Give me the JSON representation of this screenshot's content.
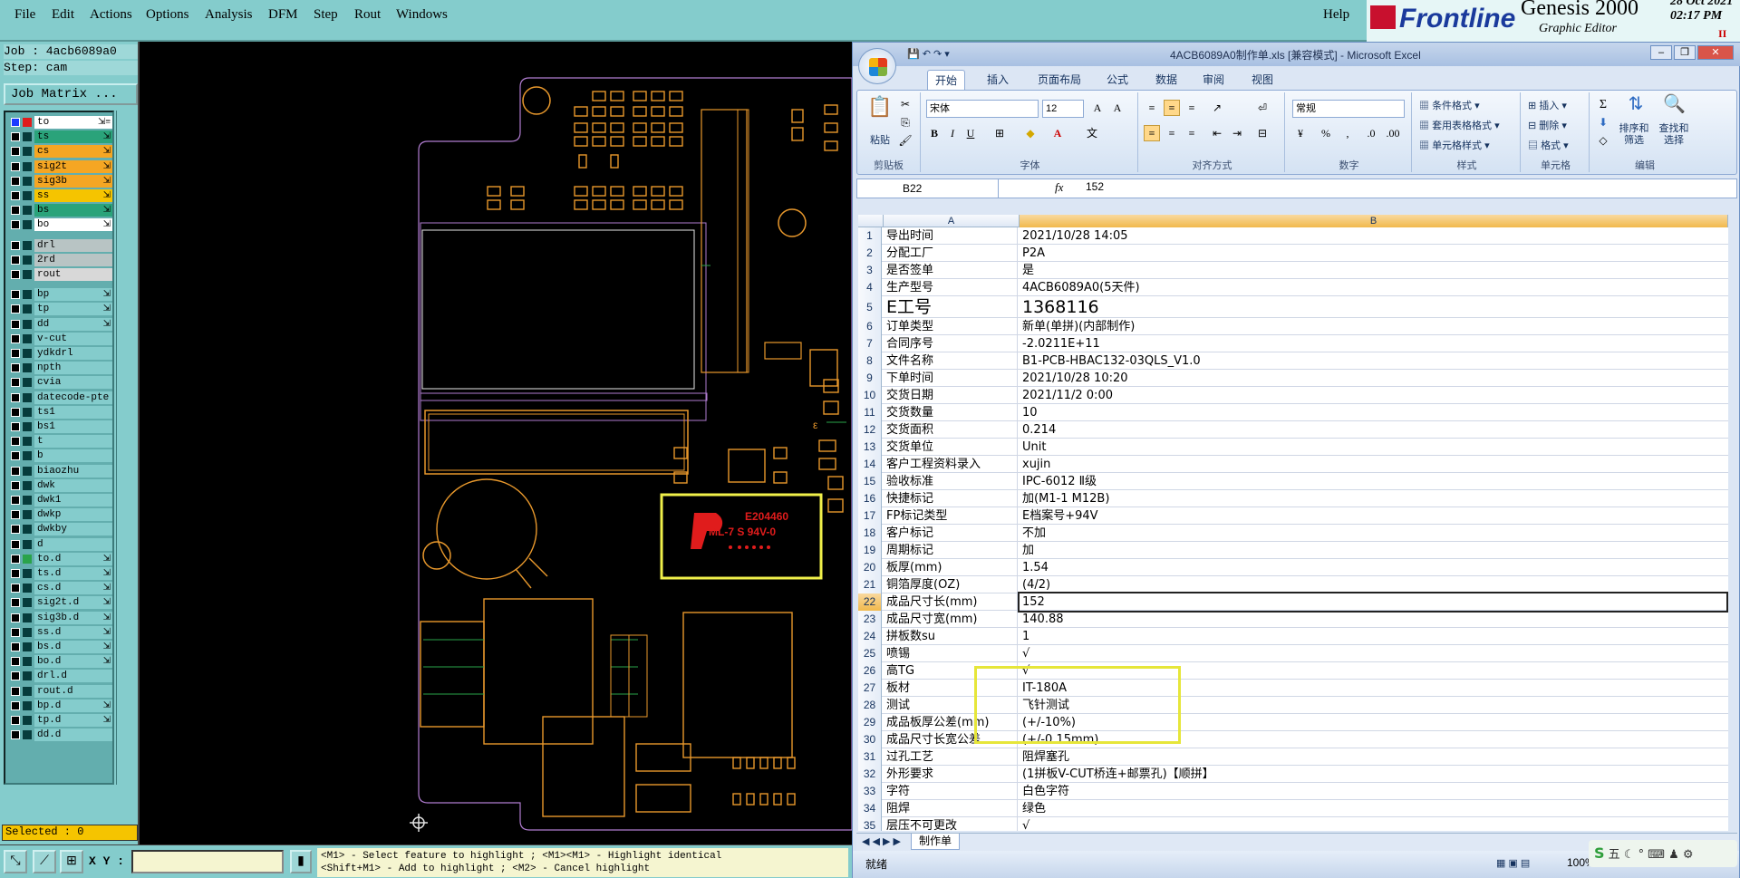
{
  "menu": {
    "file": "File",
    "edit": "Edit",
    "actions": "Actions",
    "options": "Options",
    "analysis": "Analysis",
    "dfm": "DFM",
    "step": "Step",
    "rout": "Rout",
    "windows": "Windows",
    "help": "Help"
  },
  "brand": {
    "logo": "Frontline",
    "product": "Genesis 2000",
    "subtitle": "Graphic Editor",
    "date": "28 Oct 2021",
    "time": "02:17 PM",
    "indicator": "II"
  },
  "left_panel": {
    "job": "Job : 4acb6089a0",
    "step": "Step: cam",
    "job_matrix_button": "Job Matrix ...",
    "selected": "Selected : 0",
    "layers": [
      {
        "name": "to",
        "color": "#ffffff",
        "flag": "⇲≡"
      },
      {
        "name": "ts",
        "color": "#2aa37a",
        "flag": "⇲"
      },
      {
        "name": "cs",
        "color": "#f5a623",
        "flag": "⇲"
      },
      {
        "name": "sig2t",
        "color": "#f5a623",
        "flag": "⇲"
      },
      {
        "name": "sig3b",
        "color": "#f5a623",
        "flag": "⇲"
      },
      {
        "name": "ss",
        "color": "#f5c400",
        "flag": "⇲"
      },
      {
        "name": "bs",
        "color": "#2aa37a",
        "flag": "⇲"
      },
      {
        "name": "bo",
        "color": "#ffffff",
        "flag": "⇲"
      },
      {
        "name": "drl",
        "color": "#b8c4c4",
        "flag": ""
      },
      {
        "name": "2rd",
        "color": "#b8c4c4",
        "flag": ""
      },
      {
        "name": "rout",
        "color": "#d8d8d8",
        "flag": ""
      },
      {
        "name": "bp",
        "color": "#84cccc",
        "flag": "⇲"
      },
      {
        "name": "tp",
        "color": "#84cccc",
        "flag": "⇲"
      },
      {
        "name": "dd",
        "color": "#84cccc",
        "flag": "⇲"
      },
      {
        "name": "v-cut",
        "color": "#84cccc",
        "flag": ""
      },
      {
        "name": "ydkdrl",
        "color": "#84cccc",
        "flag": ""
      },
      {
        "name": "npth",
        "color": "#84cccc",
        "flag": ""
      },
      {
        "name": "cvia",
        "color": "#84cccc",
        "flag": ""
      },
      {
        "name": "datecode-pte",
        "color": "#84cccc",
        "flag": ""
      },
      {
        "name": "ts1",
        "color": "#84cccc",
        "flag": ""
      },
      {
        "name": "bs1",
        "color": "#84cccc",
        "flag": ""
      },
      {
        "name": "t",
        "color": "#84cccc",
        "flag": ""
      },
      {
        "name": "b",
        "color": "#84cccc",
        "flag": ""
      },
      {
        "name": "biaozhu",
        "color": "#84cccc",
        "flag": ""
      },
      {
        "name": "dwk",
        "color": "#84cccc",
        "flag": ""
      },
      {
        "name": "dwk1",
        "color": "#84cccc",
        "flag": ""
      },
      {
        "name": "dwkp",
        "color": "#84cccc",
        "flag": ""
      },
      {
        "name": "dwkby",
        "color": "#84cccc",
        "flag": ""
      },
      {
        "name": "d",
        "color": "#84cccc",
        "flag": ""
      },
      {
        "name": "to.d",
        "color": "#84cccc",
        "flag": "⇲"
      },
      {
        "name": "ts.d",
        "color": "#84cccc",
        "flag": "⇲"
      },
      {
        "name": "cs.d",
        "color": "#84cccc",
        "flag": "⇲"
      },
      {
        "name": "sig2t.d",
        "color": "#84cccc",
        "flag": "⇲"
      },
      {
        "name": "sig3b.d",
        "color": "#84cccc",
        "flag": "⇲"
      },
      {
        "name": "ss.d",
        "color": "#84cccc",
        "flag": "⇲"
      },
      {
        "name": "bs.d",
        "color": "#84cccc",
        "flag": "⇲"
      },
      {
        "name": "bo.d",
        "color": "#84cccc",
        "flag": "⇲"
      },
      {
        "name": "drl.d",
        "color": "#84cccc",
        "flag": ""
      },
      {
        "name": "rout.d",
        "color": "#84cccc",
        "flag": ""
      },
      {
        "name": "bp.d",
        "color": "#84cccc",
        "flag": "⇲"
      },
      {
        "name": "tp.d",
        "color": "#84cccc",
        "flag": "⇲"
      },
      {
        "name": "dd.d",
        "color": "#84cccc",
        "flag": ""
      }
    ]
  },
  "bottom_bar": {
    "xy_label": "X Y :",
    "xy_value": "",
    "hint_line1": "<M1> - Select feature to highlight ; <M1><M1> - Highlight identical",
    "hint_line2": "<Shift+M1> - Add to highlight ; <M2> - Cancel highlight"
  },
  "canvas": {
    "marking_text1": "E204460",
    "marking_text2": "ML-7 S 94V-0"
  },
  "excel": {
    "title": "4ACB6089A0制作单.xls [兼容模式] - Microsoft Excel",
    "tabs": [
      "开始",
      "插入",
      "页面布局",
      "公式",
      "数据",
      "审阅",
      "视图"
    ],
    "ribbon": {
      "paste": "粘贴",
      "clipboard": "剪贴板",
      "font_name": "宋体",
      "font_size": "12",
      "font_group": "字体",
      "align_group": "对齐方式",
      "number_format": "常规",
      "number_group": "数字",
      "cond_format": "条件格式",
      "table_format": "套用表格格式",
      "cell_style": "单元格样式",
      "style_group": "样式",
      "insert": "插入",
      "delete": "删除",
      "format": "格式",
      "cells_group": "单元格",
      "sort_filter": "排序和筛选",
      "find_select": "查找和选择",
      "edit_group": "编辑"
    },
    "name_box": "B22",
    "formula": "152",
    "columns": [
      "A",
      "B"
    ],
    "rows": [
      {
        "n": "1",
        "a": "导出时间",
        "b": "2021/10/28 14:05"
      },
      {
        "n": "2",
        "a": "分配工厂",
        "b": "P2A"
      },
      {
        "n": "3",
        "a": "是否签单",
        "b": "是"
      },
      {
        "n": "4",
        "a": "生产型号",
        "b": "4ACB6089A0(5天件)"
      },
      {
        "n": "5",
        "a": "E工号",
        "b": "1368116"
      },
      {
        "n": "6",
        "a": "订单类型",
        "b": "新单(单拼)(内部制作)"
      },
      {
        "n": "7",
        "a": "合同序号",
        "b": "-2.0211E+11"
      },
      {
        "n": "8",
        "a": "文件名称",
        "b": "B1-PCB-HBAC132-03QLS_V1.0"
      },
      {
        "n": "9",
        "a": "下单时间",
        "b": "2021/10/28 10:20"
      },
      {
        "n": "10",
        "a": "交货日期",
        "b": "2021/11/2 0:00"
      },
      {
        "n": "11",
        "a": "交货数量",
        "b": "10"
      },
      {
        "n": "12",
        "a": "交货面积",
        "b": "0.214"
      },
      {
        "n": "13",
        "a": "交货单位",
        "b": "Unit"
      },
      {
        "n": "14",
        "a": "客户工程资料录入",
        "b": "xujin"
      },
      {
        "n": "15",
        "a": "验收标准",
        "b": "IPC-6012 Ⅱ级"
      },
      {
        "n": "16",
        "a": "快捷标记",
        "b": "加(M1-1 M12B)"
      },
      {
        "n": "17",
        "a": "FP标记类型",
        "b": "E档案号+94V"
      },
      {
        "n": "18",
        "a": "客户标记",
        "b": "不加"
      },
      {
        "n": "19",
        "a": "周期标记",
        "b": "加"
      },
      {
        "n": "20",
        "a": "板厚(mm)",
        "b": "1.54"
      },
      {
        "n": "21",
        "a": "铜箔厚度(OZ)",
        "b": "(4/2)"
      },
      {
        "n": "22",
        "a": "成品尺寸长(mm)",
        "b": "152"
      },
      {
        "n": "23",
        "a": "成品尺寸宽(mm)",
        "b": "140.88"
      },
      {
        "n": "24",
        "a": "拼板数su",
        "b": "1"
      },
      {
        "n": "25",
        "a": "喷锡",
        "b": "√"
      },
      {
        "n": "26",
        "a": "高TG",
        "b": "√"
      },
      {
        "n": "27",
        "a": "板材",
        "b": "IT-180A"
      },
      {
        "n": "28",
        "a": "测试",
        "b": "飞针测试"
      },
      {
        "n": "29",
        "a": "成品板厚公差(mm)",
        "b": "(+/-10%)"
      },
      {
        "n": "30",
        "a": "成品尺寸长宽公差",
        "b": "(+/-0.15mm)"
      },
      {
        "n": "31",
        "a": "过孔工艺",
        "b": "阻焊塞孔"
      },
      {
        "n": "32",
        "a": "外形要求",
        "b": "(1拼板V-CUT桥连+邮票孔)【顺拼】"
      },
      {
        "n": "33",
        "a": "字符",
        "b": "白色字符"
      },
      {
        "n": "34",
        "a": "阻焊",
        "b": "绿色"
      },
      {
        "n": "35",
        "a": "层压不可更改",
        "b": "√"
      }
    ],
    "sheet_tab": "制作单",
    "status": "就绪",
    "zoom": "100%",
    "ime": "五"
  }
}
